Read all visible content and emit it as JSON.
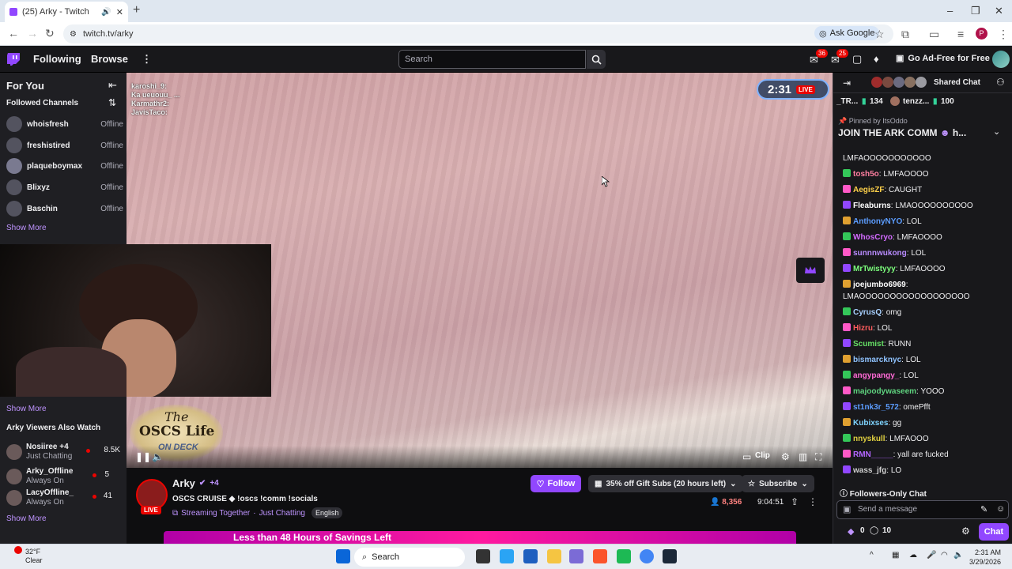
{
  "browser": {
    "tab_title": "(25) Arky - Twitch",
    "url": "twitch.tv/arky",
    "ask_google": "Ask Google",
    "profile_initial": "P"
  },
  "topnav": {
    "following": "Following",
    "browse": "Browse",
    "search_placeholder": "Search",
    "notif_count_1": "36",
    "notif_count_2": "25",
    "ad_free": "Go Ad-Free for Free"
  },
  "sidebar": {
    "for_you": "For You",
    "followed_channels": "Followed Channels",
    "channels": [
      {
        "name": "whoisfresh",
        "status": "Offline"
      },
      {
        "name": "freshistired",
        "status": "Offline"
      },
      {
        "name": "plaqueboymax",
        "status": "Offline"
      },
      {
        "name": "Blixyz",
        "status": "Offline"
      },
      {
        "name": "Baschin",
        "status": "Offline"
      }
    ],
    "show_more_1": "Show More",
    "show_more_2": "Show More",
    "also_watch": "Arky Viewers Also Watch",
    "recommended": [
      {
        "name": "Nosiiree +4",
        "game": "Just Chatting",
        "viewers": "8.5K"
      },
      {
        "name": "Arky_Offline",
        "game": "Always On",
        "viewers": "5"
      },
      {
        "name": "LacyOffline_",
        "game": "Always On",
        "viewers": "41"
      }
    ],
    "show_more_3": "Show More"
  },
  "video": {
    "timer": "2:31",
    "live": "LIVE",
    "overlay_chat": [
      "karoshi_9:",
      "Ka ueuouu_ ...",
      "Karmathr2:",
      "JavisTaco:"
    ],
    "logo_the": "The",
    "logo_name": "OSCS Life",
    "logo_sub": "ON DECK",
    "clip": "Clip"
  },
  "channel": {
    "name": "Arky",
    "plus": "+4",
    "title": "OSCS CRUISE ◆ !oscs !comm !socials",
    "streaming_together": "Streaming Together",
    "sep": "·",
    "category": "Just Chatting",
    "tag": "English",
    "live": "LIVE",
    "follow": "Follow",
    "gift_subs": "35% off Gift Subs (20 hours left)",
    "subscribe": "Subscribe",
    "viewers": "8,356",
    "uptime": "9:04:51",
    "promo": "Less than 48 Hours of Savings Left"
  },
  "chat": {
    "shared_chat": "Shared Chat",
    "hype_label": "_TR...",
    "hype_1": "134",
    "hype_user": "tenzz...",
    "hype_2": "100",
    "pinned_by": "Pinned by",
    "pinned_user": "ItsOddo",
    "pinned_msg": "JOIN THE ARK COMM",
    "pinned_tail": "h...",
    "first_line": "LMFAOOOOOOOOOOO",
    "messages": [
      {
        "user": "tosh5o",
        "text": "LMFAOOOO",
        "color": "#ff7fa0"
      },
      {
        "user": "AegisZF",
        "text": "CAUGHT",
        "color": "#ffd24a"
      },
      {
        "user": "Fleaburns",
        "text": "LMAOOOOOOOOOO",
        "color": "#ffffff"
      },
      {
        "user": "AnthonyNYO",
        "text": "LOL",
        "color": "#5c9dff"
      },
      {
        "user": "WhosCryo",
        "text": "LMFAOOOO",
        "color": "#d26bff"
      },
      {
        "user": "sunnnwukong",
        "text": "LOL",
        "color": "#b98cff"
      },
      {
        "user": "MrTwistyyy",
        "text": "LMFAOOOO",
        "color": "#7cff7c"
      },
      {
        "user": "joejumbo6969",
        "text": "",
        "color": "#ffffff"
      },
      {
        "user": "CyrusQ",
        "text": "omg",
        "color": "#a8d0ff"
      },
      {
        "user": "Hizru",
        "text": "LOL",
        "color": "#ff5c5c"
      },
      {
        "user": "Scumist",
        "text": "RUNN",
        "color": "#66e066"
      },
      {
        "user": "bismarcknyc",
        "text": "LOL",
        "color": "#8fc3ff"
      },
      {
        "user": "angypangy_",
        "text": "LOL",
        "color": "#ff6ad5"
      },
      {
        "user": "majoodywaseem",
        "text": "YOOO",
        "color": "#5fd37f"
      },
      {
        "user": "st1nk3r_572",
        "text": "omePfft",
        "color": "#5c9dff"
      },
      {
        "user": "Kubixses",
        "text": "gg",
        "color": "#7fd4ff"
      },
      {
        "user": "nnyskull",
        "text": "LMFAOOO",
        "color": "#e0d040"
      },
      {
        "user": "RMN_____",
        "text": "yall are fucked",
        "color": "#b366ff"
      },
      {
        "user": "wass_jfg",
        "text": "LO",
        "color": "#cfcfcf"
      }
    ],
    "joejumbo_text": "LMAOOOOOOOOOOOOOOOOOO",
    "followers_only": "Followers-Only Chat",
    "send_placeholder": "Send a message",
    "points_1": "0",
    "points_2": "10",
    "chat_button": "Chat"
  },
  "taskbar": {
    "temp": "32°F",
    "weather": "Clear",
    "search": "Search",
    "time": "2:31 AM",
    "date": "3/29/2026"
  }
}
